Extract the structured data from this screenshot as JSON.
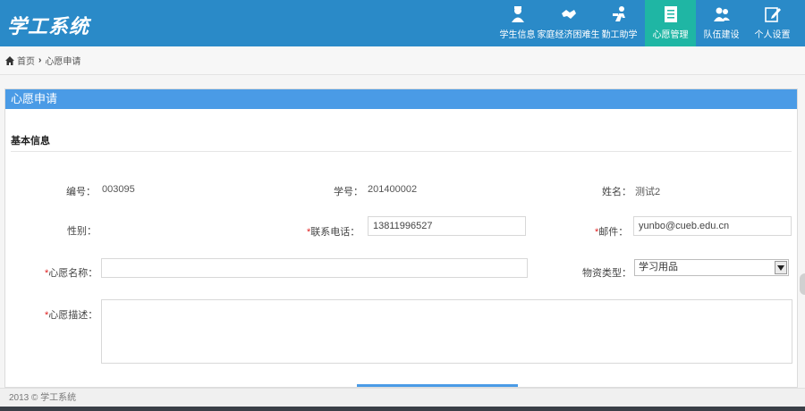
{
  "brand": {
    "title": "学工系统"
  },
  "nav": {
    "items": [
      {
        "label": "学生信息",
        "icon": "student-icon",
        "active": false
      },
      {
        "label": "家庭经济困难生",
        "icon": "handshake-icon",
        "active": false
      },
      {
        "label": "勤工助学",
        "icon": "worker-icon",
        "active": false
      },
      {
        "label": "心愿管理",
        "icon": "document-icon",
        "active": true
      },
      {
        "label": "队伍建设",
        "icon": "team-icon",
        "active": false
      },
      {
        "label": "个人设置",
        "icon": "edit-icon",
        "active": false
      }
    ]
  },
  "breadcrumb": {
    "home": "首页",
    "current": "心愿申请"
  },
  "panel": {
    "title": "心愿申请",
    "section": "基本信息"
  },
  "form": {
    "id_label": "编号：",
    "id_value": "003095",
    "student_no_label": "学号：",
    "student_no_value": "201400002",
    "name_label": "姓名：",
    "name_value": "测试2",
    "gender_label": "性别：",
    "phone_label": "联系电话：",
    "phone_value": "13811996527",
    "email_label": "邮件：",
    "email_value": "yunbo@cueb.edu.cn",
    "wish_name_label": "心愿名称：",
    "wish_name_value": "",
    "category_label": "物资类型：",
    "category_value": "学习用品",
    "desc_label": "心愿描述：",
    "desc_value": ""
  },
  "footer": {
    "text": "2013 © 学工系统"
  },
  "colors": {
    "header": "#2a8ac8",
    "active_tab": "#1fb6a4",
    "panel_head": "#4a9be6",
    "required": "#e02020"
  }
}
